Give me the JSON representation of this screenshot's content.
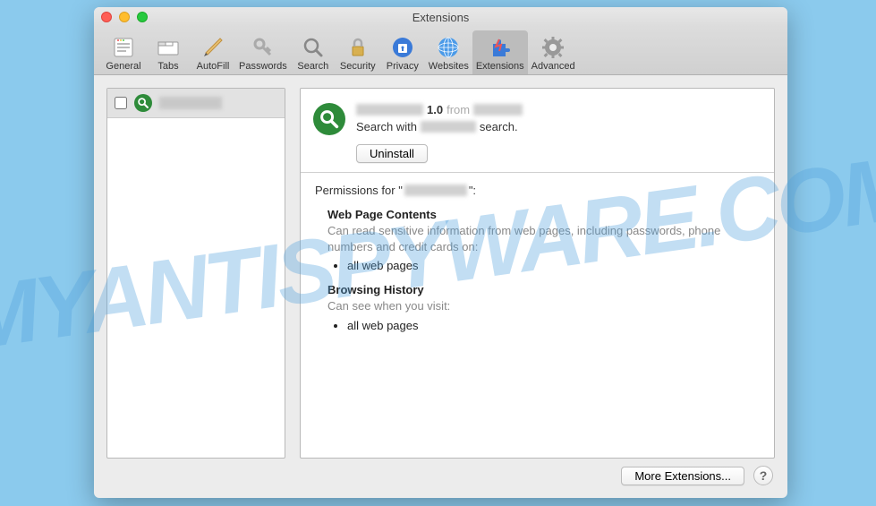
{
  "window": {
    "title": "Extensions"
  },
  "toolbar": {
    "items": [
      {
        "label": "General"
      },
      {
        "label": "Tabs"
      },
      {
        "label": "AutoFill"
      },
      {
        "label": "Passwords"
      },
      {
        "label": "Search"
      },
      {
        "label": "Security"
      },
      {
        "label": "Privacy"
      },
      {
        "label": "Websites"
      },
      {
        "label": "Extensions"
      },
      {
        "label": "Advanced"
      }
    ]
  },
  "extension": {
    "version": "1.0",
    "from": "from",
    "desc_prefix": "Search with",
    "desc_suffix": "search.",
    "uninstall_label": "Uninstall"
  },
  "permissions": {
    "title_prefix": "Permissions for \"",
    "title_suffix": "\":",
    "sections": [
      {
        "head": "Web Page Contents",
        "desc": "Can read sensitive information from web pages, including passwords, phone numbers and credit cards on:",
        "items": [
          "all web pages"
        ]
      },
      {
        "head": "Browsing History",
        "desc": "Can see when you visit:",
        "items": [
          "all web pages"
        ]
      }
    ]
  },
  "footer": {
    "more_label": "More Extensions...",
    "help_label": "?"
  },
  "watermark": "MYANTISPYWARE.COM"
}
